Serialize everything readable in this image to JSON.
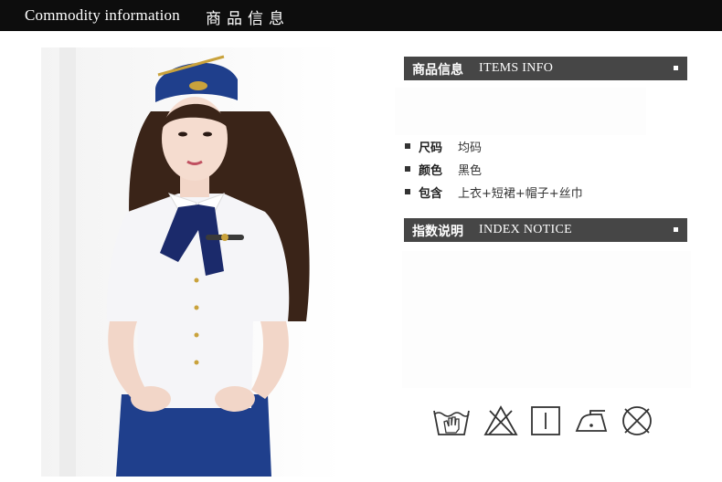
{
  "header": {
    "title_en": "Commodity information",
    "title_cn": "商品信息"
  },
  "product_photo": {
    "description_icon": "model-photo"
  },
  "items_info": {
    "title_cn": "商品信息",
    "title_en": "ITEMS INFO",
    "specs": [
      {
        "label": "尺码",
        "value": "均码"
      },
      {
        "label": "颜色",
        "value": "黑色"
      },
      {
        "label": "包含",
        "value": "上衣+短裙+帽子+丝巾"
      }
    ]
  },
  "index_notice": {
    "title_cn": "指数说明",
    "title_en": "INDEX NOTICE"
  },
  "care_icons": [
    "hand-wash-icon",
    "no-bleach-icon",
    "line-dry-icon",
    "iron-low-icon",
    "no-dry-clean-icon"
  ],
  "colors": {
    "header_bar": "#0d0d0d",
    "section_bar": "#464646",
    "uniform_blue": "#1f3f8c"
  }
}
